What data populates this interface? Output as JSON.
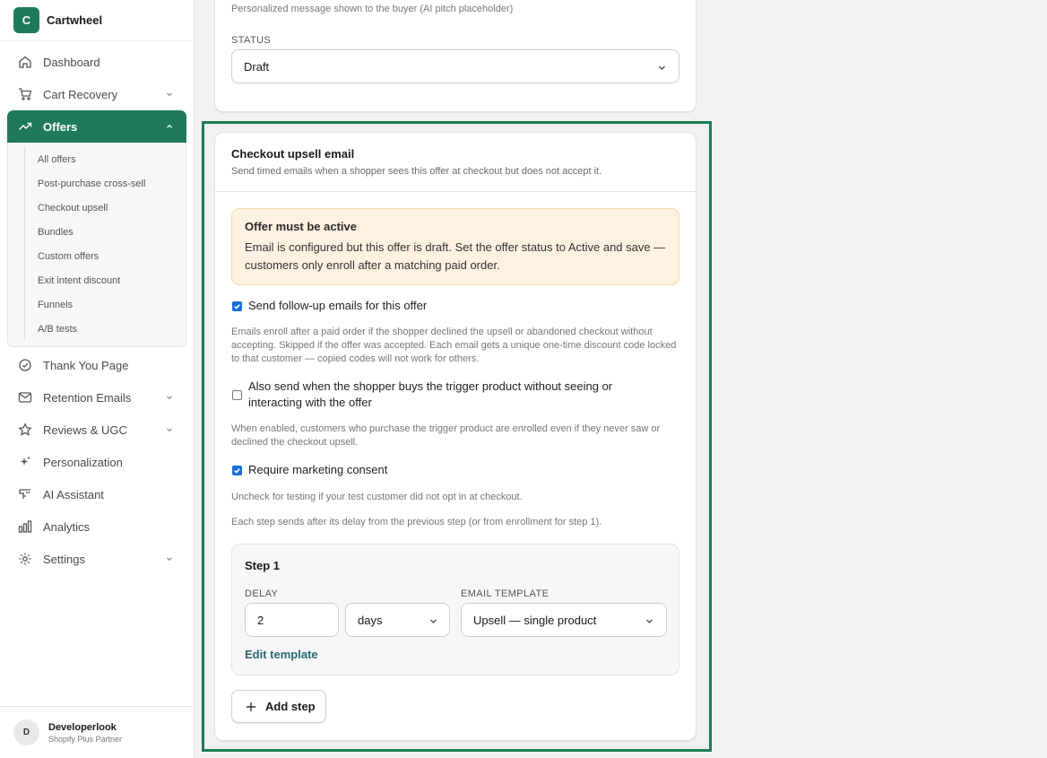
{
  "brand": {
    "logo_letter": "C",
    "name": "Cartwheel",
    "color": "#1f7a5c"
  },
  "nav": {
    "dashboard": "Dashboard",
    "cart_recovery": "Cart Recovery",
    "offers": "Offers",
    "offers_sub": [
      "All offers",
      "Post-purchase cross-sell",
      "Checkout upsell",
      "Bundles",
      "Custom offers",
      "Exit intent discount",
      "Funnels",
      "A/B tests"
    ],
    "thank_you": "Thank You Page",
    "retention": "Retention Emails",
    "reviews": "Reviews & UGC",
    "personalization": "Personalization",
    "ai": "AI Assistant",
    "analytics": "Analytics",
    "settings": "Settings"
  },
  "user": {
    "initial": "D",
    "name": "Developerlook",
    "role": "Shopify Plus Partner"
  },
  "top_card": {
    "helper": "Personalized message shown to the buyer (AI pitch placeholder)",
    "status_label": "STATUS",
    "status_value": "Draft"
  },
  "email_card": {
    "title": "Checkout upsell email",
    "subtitle": "Send timed emails when a shopper sees this offer at checkout but does not accept it.",
    "banner_title": "Offer must be active",
    "banner_body": "Email is configured but this offer is draft. Set the offer status to Active and save — customers only enroll after a matching paid order.",
    "opt_followup": {
      "label": "Send follow-up emails for this offer",
      "checked": true
    },
    "followup_help": "Emails enroll after a paid order if the shopper declined the upsell or abandoned checkout without accepting. Skipped if the offer was accepted. Each email gets a unique one-time discount code locked to that customer — copied codes will not work for others.",
    "opt_trigger": {
      "label": "Also send when the shopper buys the trigger product without seeing or interacting with the offer",
      "checked": false
    },
    "trigger_help": "When enabled, customers who purchase the trigger product are enrolled even if they never saw or declined the checkout upsell.",
    "opt_consent": {
      "label": "Require marketing consent",
      "checked": true
    },
    "consent_help": "Uncheck for testing if your test customer did not opt in at checkout.",
    "steps_help": "Each step sends after its delay from the previous step (or from enrollment for step 1).",
    "step": {
      "title": "Step 1",
      "delay_label": "DELAY",
      "delay_value": "2",
      "unit_value": "days",
      "template_label": "EMAIL TEMPLATE",
      "template_value": "Upsell — single product",
      "edit_link": "Edit template"
    },
    "add_step": "Add step"
  },
  "colors": {
    "highlight": "#1a7f52",
    "banner_bg": "#fdf1e1",
    "checkbox": "#1a6ed8",
    "link": "#2a6670"
  }
}
